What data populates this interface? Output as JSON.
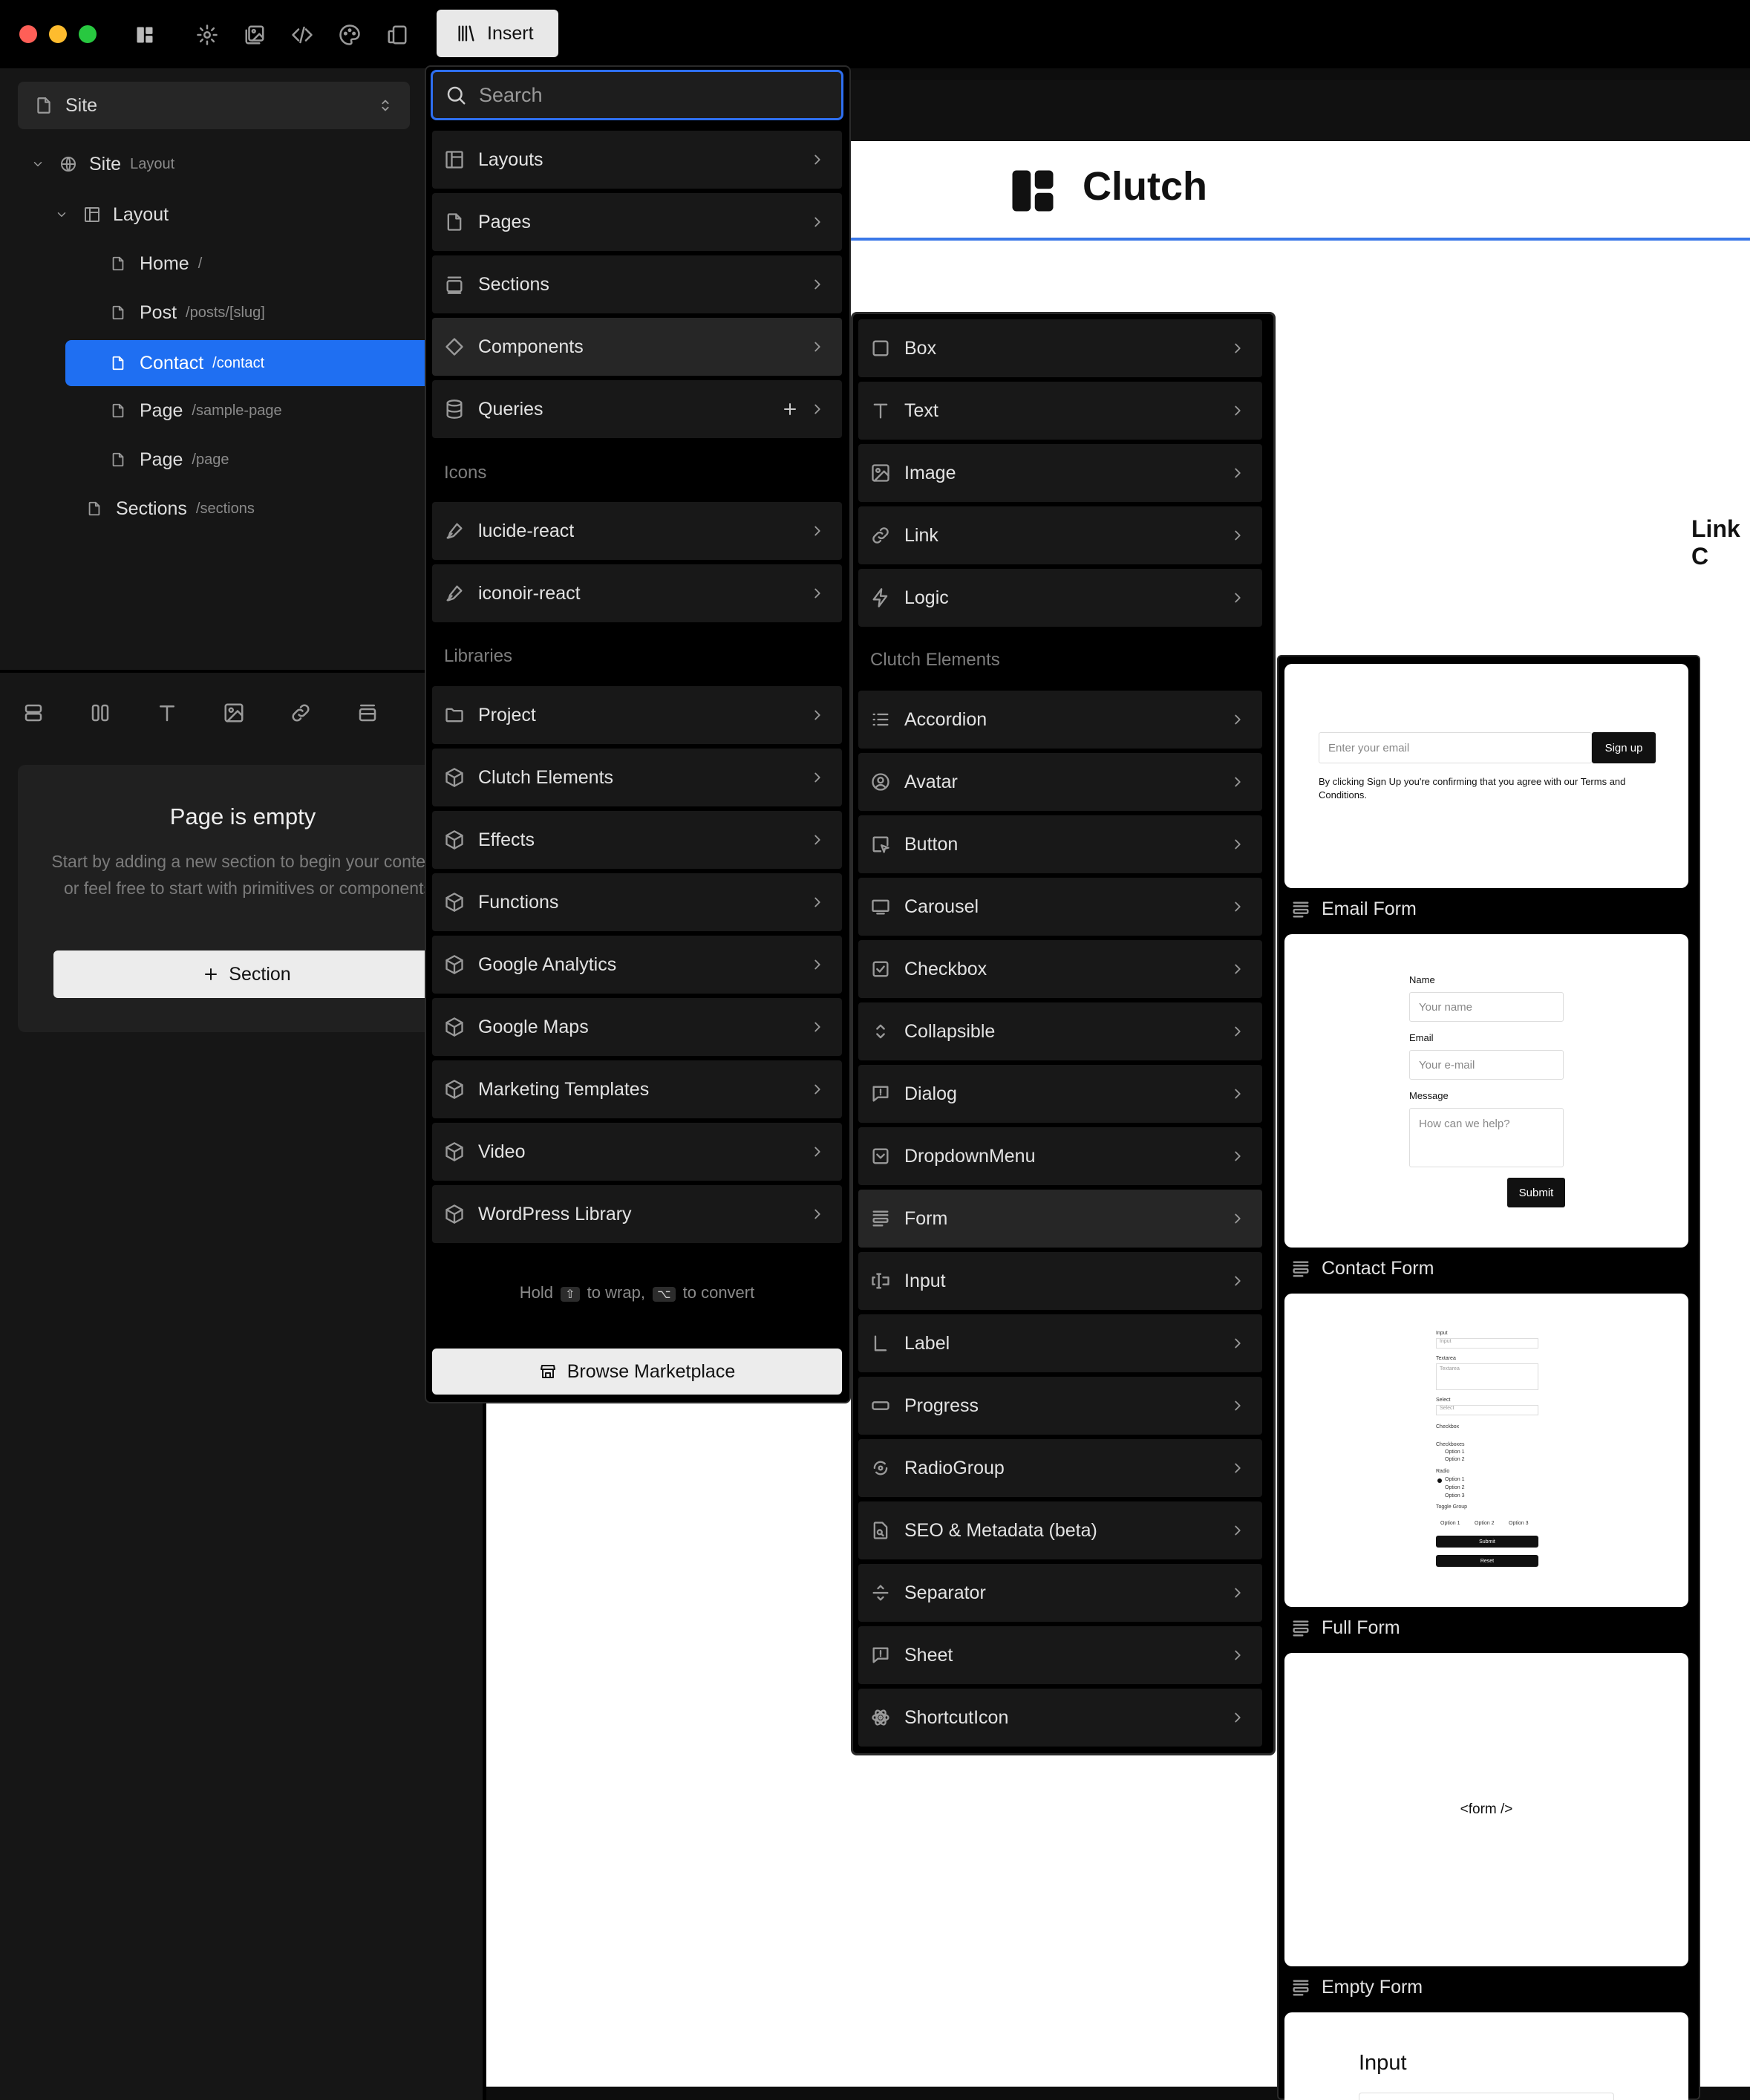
{
  "toolbar": {
    "insert_label": "Insert"
  },
  "site_select": {
    "label": "Site"
  },
  "tree": [
    {
      "label": "Site",
      "sub": "Layout"
    },
    {
      "label": "Layout",
      "sub": ""
    },
    {
      "label": "Home",
      "sub": "/"
    },
    {
      "label": "Post",
      "sub": "/posts/[slug]"
    },
    {
      "label": "Contact",
      "sub": "/contact"
    },
    {
      "label": "Page",
      "sub": "/sample-page"
    },
    {
      "label": "Page",
      "sub": "/page"
    },
    {
      "label": "Sections",
      "sub": "/sections"
    }
  ],
  "empty_state": {
    "title": "Page is empty",
    "description": "Start by adding a new section to begin your content, or feel free to start with primitives or components",
    "button_label": "Section"
  },
  "canvas": {
    "logo_text": "Clutch",
    "link_text": "Link C"
  },
  "insert_menu": {
    "search_placeholder": "Search",
    "items": [
      {
        "label": "Layouts"
      },
      {
        "label": "Pages"
      },
      {
        "label": "Sections"
      },
      {
        "label": "Components"
      },
      {
        "label": "Queries"
      }
    ],
    "icons_heading": "Icons",
    "icon_items": [
      {
        "label": "lucide-react"
      },
      {
        "label": "iconoir-react"
      }
    ],
    "libraries_heading": "Libraries",
    "library_items": [
      {
        "label": "Project"
      },
      {
        "label": "Clutch Elements"
      },
      {
        "label": "Effects"
      },
      {
        "label": "Functions"
      },
      {
        "label": "Google Analytics"
      },
      {
        "label": "Google Maps"
      },
      {
        "label": "Marketing Templates"
      },
      {
        "label": "Video"
      },
      {
        "label": "WordPress Library"
      }
    ],
    "hint_hold": "Hold",
    "hint_key1": "⇧",
    "hint_mid": "to wrap,",
    "hint_key2": "⌥",
    "hint_end": "to convert",
    "marketplace_label": "Browse Marketplace"
  },
  "components_menu": {
    "primitives": [
      {
        "label": "Box"
      },
      {
        "label": "Text"
      },
      {
        "label": "Image"
      },
      {
        "label": "Link"
      },
      {
        "label": "Logic"
      }
    ],
    "elements_heading": "Clutch Elements",
    "elements": [
      {
        "label": "Accordion"
      },
      {
        "label": "Avatar"
      },
      {
        "label": "Button"
      },
      {
        "label": "Carousel"
      },
      {
        "label": "Checkbox"
      },
      {
        "label": "Collapsible"
      },
      {
        "label": "Dialog"
      },
      {
        "label": "DropdownMenu"
      },
      {
        "label": "Form"
      },
      {
        "label": "Input"
      },
      {
        "label": "Label"
      },
      {
        "label": "Progress"
      },
      {
        "label": "RadioGroup"
      },
      {
        "label": "SEO & Metadata (beta)"
      },
      {
        "label": "Separator"
      },
      {
        "label": "Sheet"
      },
      {
        "label": "ShortcutIcon"
      }
    ]
  },
  "form_previews": {
    "email_form": {
      "label": "Email Form",
      "placeholder": "Enter your email",
      "button": "Sign up",
      "terms": "By clicking Sign Up you're confirming that you agree with our Terms and Conditions."
    },
    "contact_form": {
      "label": "Contact Form",
      "name_label": "Name",
      "name_placeholder": "Your name",
      "email_label": "Email",
      "email_placeholder": "Your e-mail",
      "message_label": "Message",
      "message_placeholder": "How can we help?",
      "submit": "Submit"
    },
    "full_form": {
      "label": "Full Form",
      "input_label": "Input",
      "input_placeholder": "Input",
      "textarea_label": "Textarea",
      "textarea_placeholder": "Textarea",
      "select_label": "Select",
      "select_placeholder": "Select",
      "checkbox_label": "Checkbox",
      "checkboxes_label": "Checkboxes",
      "checkbox_options": [
        "Option 1",
        "Option 2"
      ],
      "radio_label": "Radio",
      "radio_options": [
        "Option 1",
        "Option 2",
        "Option 3"
      ],
      "toggle_label": "Toggle Group",
      "toggle_options": [
        "Option 1",
        "Option 2",
        "Option 3"
      ],
      "submit": "Submit",
      "reset": "Reset"
    },
    "empty_form": {
      "label": "Empty Form",
      "code": "<form />"
    },
    "input_card": {
      "title": "Input"
    }
  }
}
